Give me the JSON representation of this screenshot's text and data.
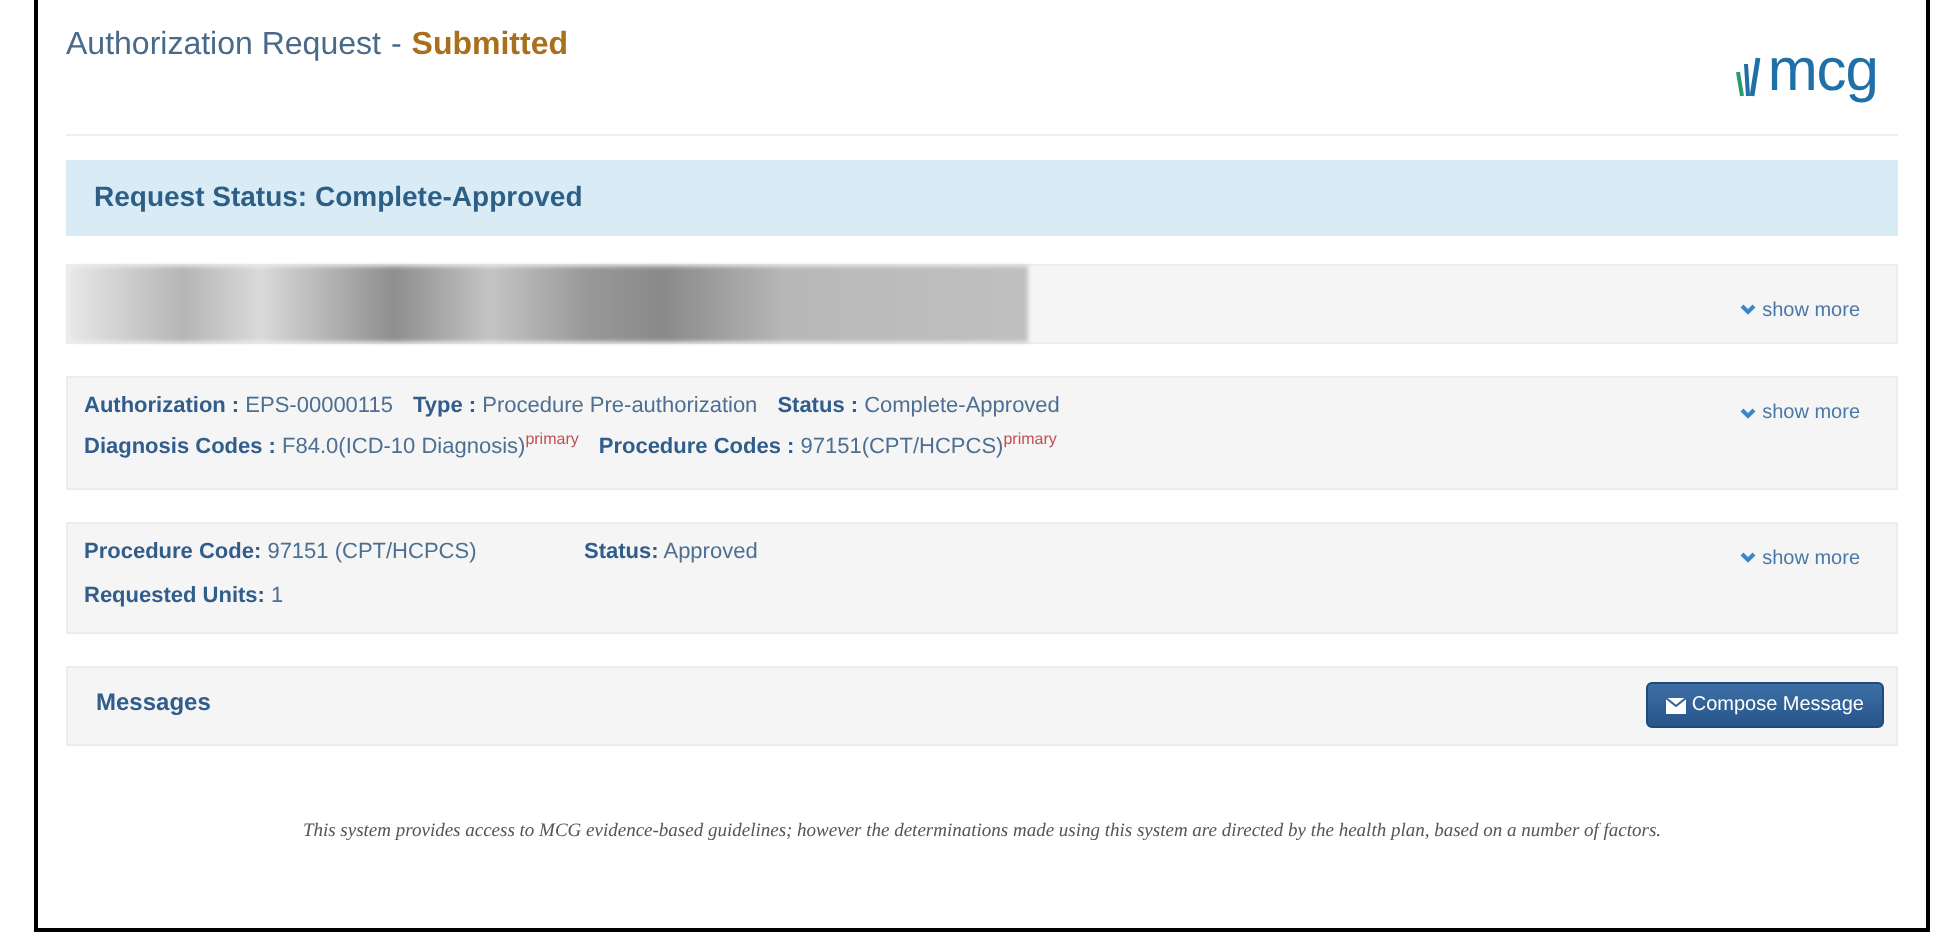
{
  "header": {
    "title": "Authorization Request",
    "separator": "-",
    "status": "Submitted",
    "logo": "mcg"
  },
  "status_banner": {
    "label": "Request Status: Complete-Approved"
  },
  "panels": [
    {
      "kind": "redacted",
      "toggle": "show more"
    },
    {
      "kind": "inline",
      "toggle": "show more",
      "lines": [
        [
          {
            "label": "Authorization :",
            "value": "EPS-00000115"
          },
          {
            "label": "Type :",
            "value": "Procedure Pre-authorization"
          },
          {
            "label": "Status :",
            "value": "Complete-Approved"
          }
        ],
        [
          {
            "label": "Diagnosis Codes :",
            "value": "F84.0(ICD-10 Diagnosis)",
            "tag": "primary"
          },
          {
            "label": "Procedure Codes :",
            "value": "97151(CPT/HCPCS)",
            "tag": "primary"
          }
        ]
      ]
    },
    {
      "kind": "grid",
      "toggle": "show more",
      "lines": [
        [
          {
            "label": "Procedure Code:",
            "value": "97151 (CPT/HCPCS)"
          },
          {
            "label": "Status:",
            "value": "Approved"
          }
        ],
        [
          {
            "label": "Requested Units:",
            "value": "1"
          }
        ]
      ]
    }
  ],
  "messages": {
    "title": "Messages",
    "button": "Compose Message"
  },
  "footer": "This system provides access to MCG evidence-based guidelines; however the determinations made using this system are directed by the health plan, based on a number of factors."
}
